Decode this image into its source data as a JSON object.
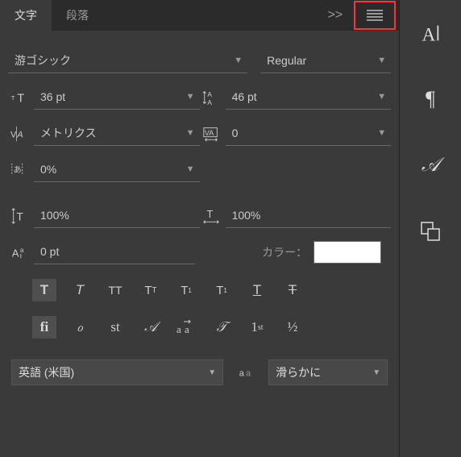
{
  "tabs": {
    "character": "文字",
    "paragraph": "段落",
    "expand": ">>"
  },
  "font": {
    "family": "游ゴシック",
    "style": "Regular"
  },
  "size": {
    "font": "36 pt",
    "leading": "46 pt"
  },
  "kern": {
    "kerning": "メトリクス",
    "tracking": "0"
  },
  "tsume": "0%",
  "scale": {
    "v": "100%",
    "h": "100%"
  },
  "baseline": "0 pt",
  "color_label": "カラー：",
  "lang": "英語 (米国)",
  "aa": "滑らかに"
}
